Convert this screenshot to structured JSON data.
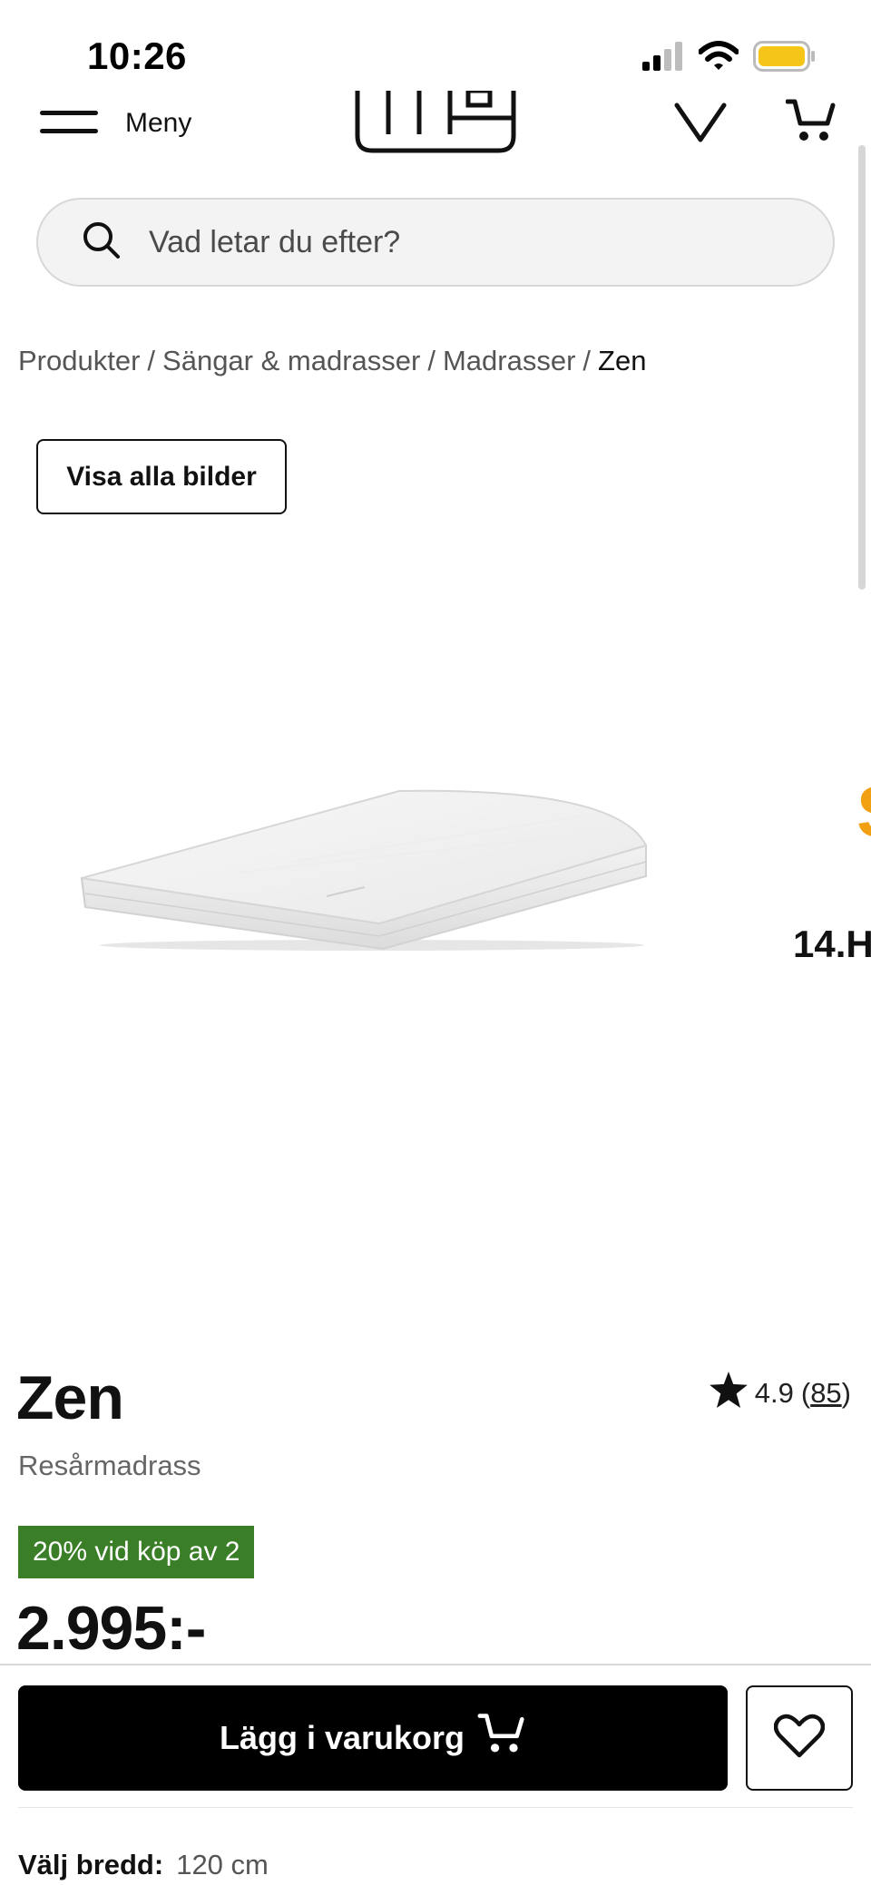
{
  "status_bar": {
    "time": "10:26"
  },
  "header": {
    "menu_label": "Meny"
  },
  "search": {
    "placeholder": "Vad letar du efter?"
  },
  "breadcrumb": {
    "items": [
      "Produkter",
      "Sängar & madrasser",
      "Madrasser"
    ],
    "current": "Zen",
    "separator": "/"
  },
  "gallery": {
    "show_all_label": "Visa alla bilder",
    "next_slide_peek_text": "14.H",
    "next_slide_peek_glyph": "S"
  },
  "product": {
    "name": "Zen",
    "type": "Resårmadrass",
    "rating": "4.9",
    "review_count_open": "(",
    "review_count": "85",
    "review_count_close": ")",
    "promo": "20% vid köp av 2",
    "price": "2.995:-"
  },
  "actions": {
    "add_to_cart_label": "Lägg i varukorg"
  },
  "width_selector": {
    "label": "Välj bredd:",
    "value": "120 cm"
  },
  "colors": {
    "promo_green": "#3a7f27",
    "battery_yellow": "#f5c518",
    "accent_orange": "#f0a010",
    "button_black": "#000000"
  }
}
